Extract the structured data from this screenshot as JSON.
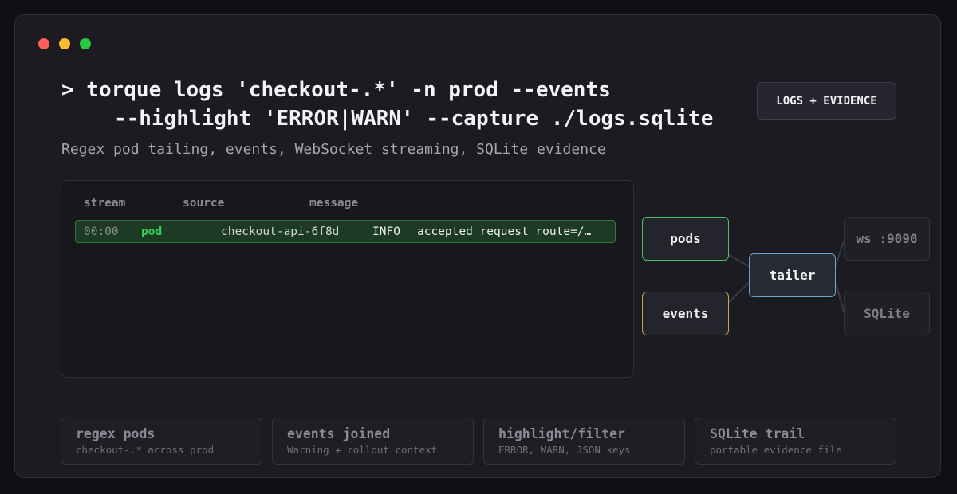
{
  "window": {
    "controls": [
      "close",
      "minimize",
      "maximize"
    ]
  },
  "command": {
    "line1": "> torque logs 'checkout-.*' -n prod --events",
    "line2": "--highlight 'ERROR|WARN' --capture ./logs.sqlite"
  },
  "badge": "LOGS + EVIDENCE",
  "subtitle": "Regex pod tailing, events, WebSocket streaming, SQLite evidence",
  "log_table": {
    "headers": [
      "stream",
      "source",
      "message"
    ],
    "rows": [
      {
        "time": "00:00",
        "stream": "pod",
        "source": "checkout-api-6f8d",
        "level": "INFO",
        "message": "accepted request route=/…"
      }
    ]
  },
  "pipeline": {
    "inputs": [
      {
        "label": "pods",
        "color": "#4cbf6a"
      },
      {
        "label": "events",
        "color": "#c9a24a"
      }
    ],
    "hub": {
      "label": "tailer",
      "color": "#6aa6cf"
    },
    "outputs": [
      {
        "label": "ws :9090"
      },
      {
        "label": "SQLite"
      }
    ]
  },
  "features": [
    {
      "title": "regex pods",
      "desc": "checkout-.* across prod"
    },
    {
      "title": "events joined",
      "desc": "Warning + rollout context"
    },
    {
      "title": "highlight/filter",
      "desc": "ERROR, WARN, JSON keys"
    },
    {
      "title": "SQLite trail",
      "desc": "portable evidence file"
    }
  ],
  "colors": {
    "background": "#101014",
    "window": "#1b1b21",
    "row_highlight": "#1d3a24",
    "stream_pod": "#34d058"
  }
}
